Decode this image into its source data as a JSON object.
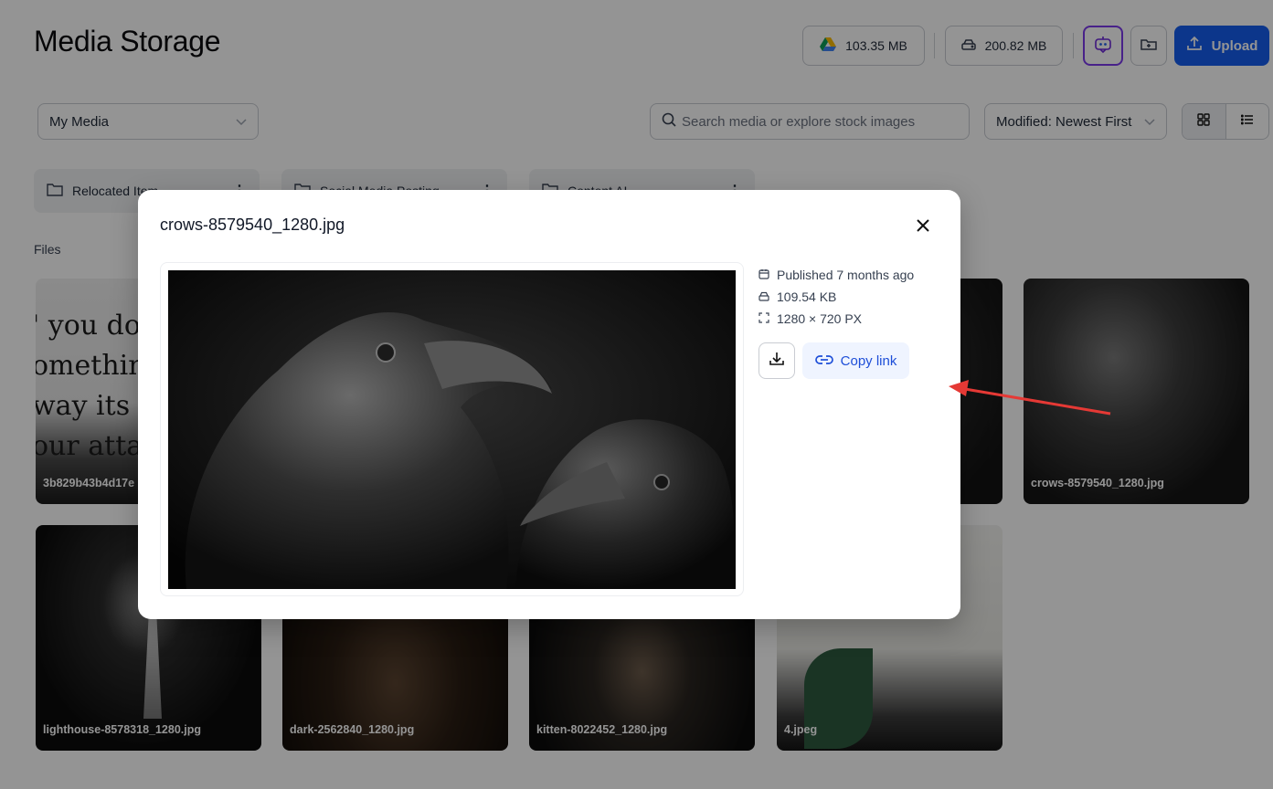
{
  "page": {
    "title": "Media Storage",
    "files_label": "Files"
  },
  "header": {
    "drive_usage": "103.35 MB",
    "local_usage": "200.82 MB",
    "upload_label": "Upload"
  },
  "filters": {
    "source_select": "My Media",
    "search_placeholder": "Search media or explore stock images",
    "sort_select": "Modified: Newest First"
  },
  "folders": [
    {
      "name": "Relocated Item"
    },
    {
      "name": "Social Media Posting"
    },
    {
      "name": "Content AI"
    }
  ],
  "files": [
    {
      "name": "3b829b43b4d17e"
    },
    {
      "name": "crows-8579540_1280.jpg"
    },
    {
      "name": "lighthouse-8578318_1280.jpg"
    },
    {
      "name": "dark-2562840_1280.jpg"
    },
    {
      "name": "kitten-8022452_1280.jpg"
    },
    {
      "name": "4.jpeg"
    }
  ],
  "quote_text": "' you do\nomething\nway its c\nour atta",
  "modal": {
    "title": "crows-8579540_1280.jpg",
    "published": "Published 7 months ago",
    "size": "109.54 KB",
    "dimensions": "1280 × 720 PX",
    "copy_link_label": "Copy link"
  },
  "colors": {
    "primary": "#155eef",
    "copy_bg": "#eff4ff",
    "copy_text": "#1d4ed8",
    "annotation_arrow": "#e53935"
  },
  "icons": [
    "google-drive-icon",
    "hard-drive-icon",
    "ai-assistant-icon",
    "folder-plus-icon",
    "upload-icon",
    "chevron-down-icon",
    "search-icon",
    "grid-view-icon",
    "list-view-icon",
    "folder-icon",
    "kebab-menu-icon",
    "close-icon",
    "calendar-icon",
    "hard-drive-icon",
    "dimensions-icon",
    "download-icon",
    "link-icon"
  ]
}
